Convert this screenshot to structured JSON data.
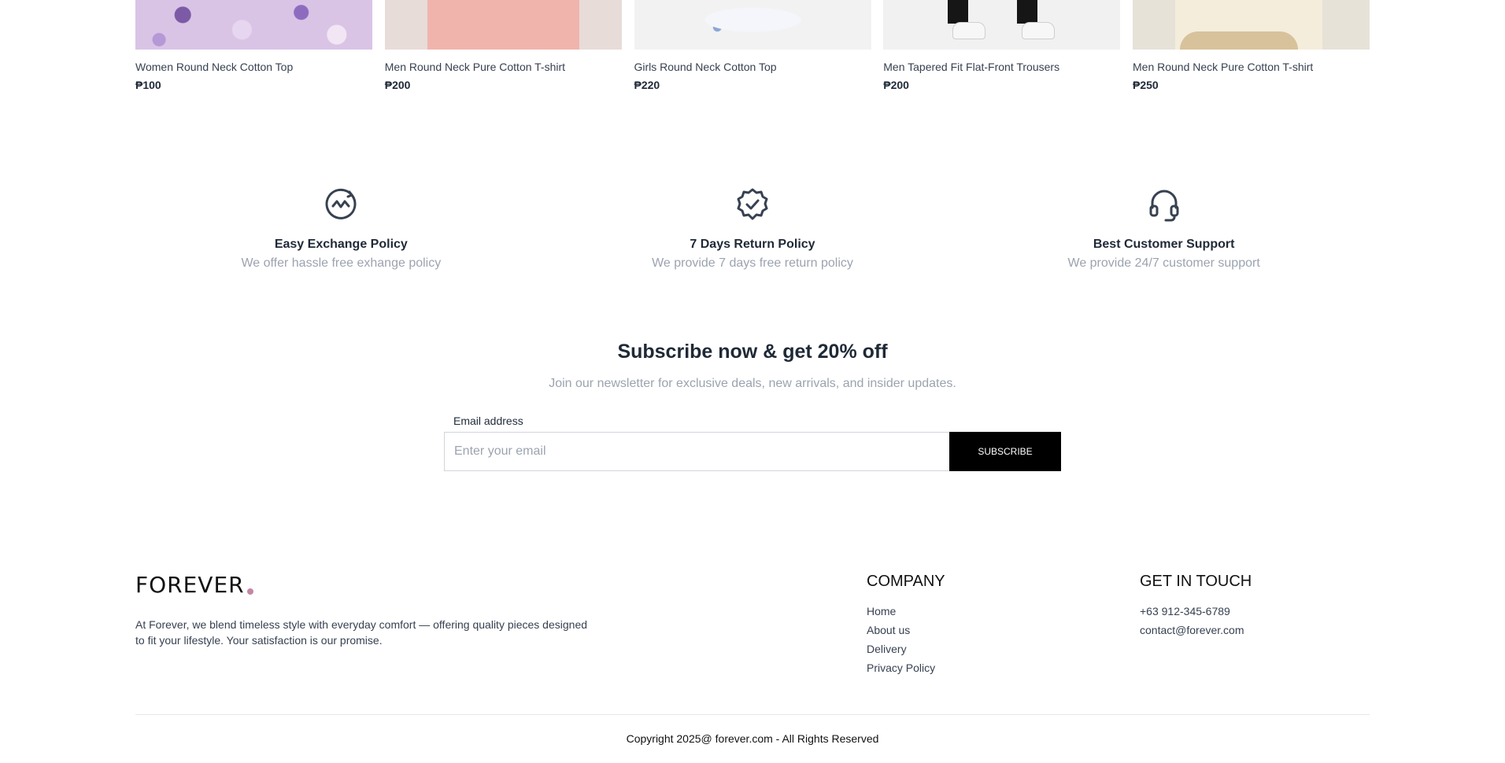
{
  "products": [
    {
      "name": "Women Round Neck Cotton Top",
      "price": "₱100"
    },
    {
      "name": "Men Round Neck Pure Cotton T-shirt",
      "price": "₱200"
    },
    {
      "name": "Girls Round Neck Cotton Top",
      "price": "₱220"
    },
    {
      "name": "Men Tapered Fit Flat-Front Trousers",
      "price": "₱200"
    },
    {
      "name": "Men Round Neck Pure Cotton T-shirt",
      "price": "₱250"
    }
  ],
  "policies": [
    {
      "icon": "exchange-icon",
      "title": "Easy Exchange Policy",
      "desc": "We offer hassle free exhange policy"
    },
    {
      "icon": "quality-badge-icon",
      "title": "7 Days Return Policy",
      "desc": "We provide 7 days free return policy"
    },
    {
      "icon": "headset-icon",
      "title": "Best Customer Support",
      "desc": "We provide 24/7 customer support"
    }
  ],
  "subscribe": {
    "title": "Subscribe now & get 20% off",
    "subtitle": "Join our newsletter for exclusive deals, new arrivals, and insider updates.",
    "email_label": "Email address",
    "email_placeholder": "Enter your email",
    "email_value": "",
    "button_label": "SUBSCRIBE"
  },
  "footer": {
    "brand": "FOREVER",
    "brand_dot_color": "#c586a5",
    "about": "At Forever, we blend timeless style with everyday comfort — offering quality pieces designed to fit your lifestyle. Your satisfaction is our promise.",
    "company": {
      "heading": "COMPANY",
      "links": [
        "Home",
        "About us",
        "Delivery",
        "Privacy Policy"
      ]
    },
    "contact": {
      "heading": "GET IN TOUCH",
      "phone": "+63 912-345-6789",
      "email": "contact@forever.com"
    },
    "copyright": "Copyright 2025@ forever.com - All Rights Reserved"
  }
}
